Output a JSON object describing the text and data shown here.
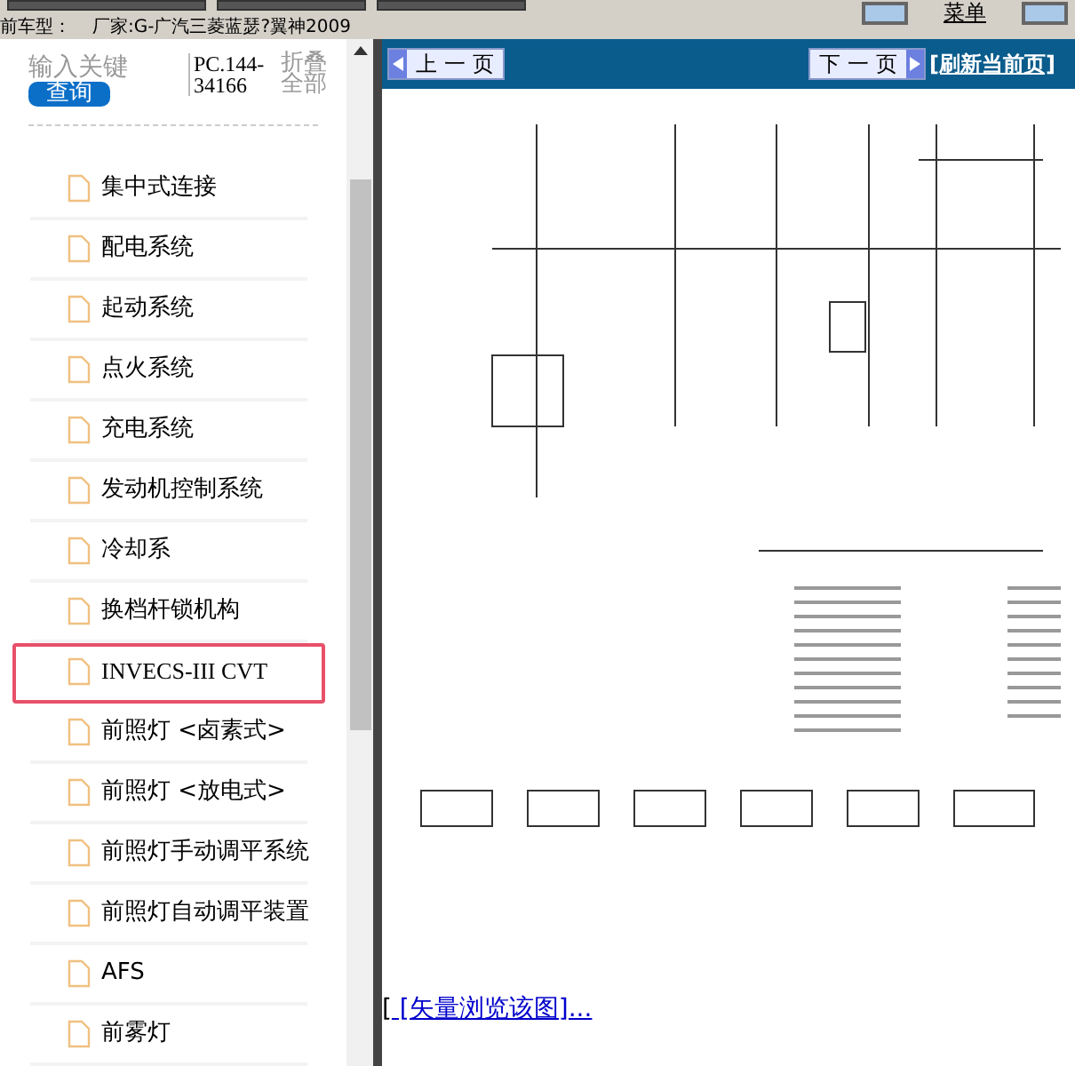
{
  "toolbar": {
    "menu_label": "菜单"
  },
  "info_bar": {
    "label": "前车型：",
    "value": "厂家:G-广汽三菱蓝瑟?翼神2009"
  },
  "sidebar": {
    "search": {
      "placeholder": "输入关键"
    },
    "search_button": "查询",
    "code": "PC.144-34166",
    "collapse_link": "折叠全部",
    "items": [
      {
        "label": "集中式连接",
        "selected": false
      },
      {
        "label": "配电系统",
        "selected": false
      },
      {
        "label": "起动系统",
        "selected": false
      },
      {
        "label": "点火系统",
        "selected": false
      },
      {
        "label": "充电系统",
        "selected": false
      },
      {
        "label": "发动机控制系统",
        "selected": false
      },
      {
        "label": "冷却系",
        "selected": false
      },
      {
        "label": "换档杆锁机构",
        "selected": false
      },
      {
        "label": "INVECS-III CVT",
        "selected": true
      },
      {
        "label": "前照灯 <卤素式>",
        "selected": false
      },
      {
        "label": "前照灯 <放电式>",
        "selected": false
      },
      {
        "label": "前照灯手动调平系统",
        "selected": false
      },
      {
        "label": "前照灯自动调平装置",
        "selected": false
      },
      {
        "label": "AFS",
        "selected": false
      },
      {
        "label": "前雾灯",
        "selected": false
      }
    ]
  },
  "viewer": {
    "prev_button": "上 一 页",
    "next_button": "下 一 页",
    "refresh_link": "[刷新当前页]",
    "vector_prefix": "[",
    "vector_link": " [矢量浏览该图]..."
  }
}
